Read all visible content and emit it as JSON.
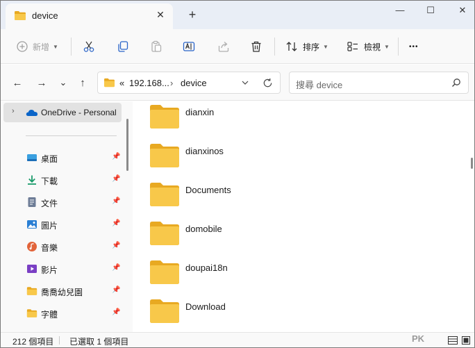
{
  "tab": {
    "title": "device",
    "close_glyph": "✕",
    "new_tab_glyph": "+"
  },
  "window_controls": {
    "minimize": "—",
    "maximize": "☐",
    "close": "✕"
  },
  "toolbar": {
    "new_label": "新增",
    "sort_label": "排序",
    "view_label": "檢視",
    "more_glyph": "•••",
    "icons": [
      "add-icon",
      "cut-icon",
      "copy-icon",
      "paste-icon",
      "rename-icon",
      "share-icon",
      "delete-icon",
      "sort-icon",
      "view-icon",
      "more-icon"
    ]
  },
  "navigation": {
    "back_glyph": "←",
    "forward_glyph": "→",
    "recent_glyph": "⌄",
    "up_glyph": "↑",
    "breadcrumb_overflow": "«",
    "breadcrumb": [
      "192.168...",
      "device"
    ],
    "breadcrumb_sep": "›",
    "search_placeholder": "搜尋 device"
  },
  "sidebar": {
    "onedrive": {
      "label": "OneDrive - Personal"
    },
    "items": [
      {
        "label": "桌面",
        "icon": "desktop-icon"
      },
      {
        "label": "下載",
        "icon": "download-icon"
      },
      {
        "label": "文件",
        "icon": "documents-icon"
      },
      {
        "label": "圖片",
        "icon": "pictures-icon"
      },
      {
        "label": "音樂",
        "icon": "music-icon"
      },
      {
        "label": "影片",
        "icon": "videos-icon"
      },
      {
        "label": "喬喬幼兒園",
        "icon": "folder-icon"
      },
      {
        "label": "字體",
        "icon": "folder-icon"
      }
    ]
  },
  "files": [
    {
      "name": "dianxin"
    },
    {
      "name": "dianxinos"
    },
    {
      "name": "Documents"
    },
    {
      "name": "domobile"
    },
    {
      "name": "doupai18n"
    },
    {
      "name": "Download"
    }
  ],
  "status": {
    "count": "212 個項目",
    "selected": "已選取 1 個項目",
    "watermark": "PK"
  },
  "colors": {
    "folder_yellow": "#f8c84a",
    "folder_dark": "#e8a922",
    "accent_blue": "#0a64c8"
  }
}
